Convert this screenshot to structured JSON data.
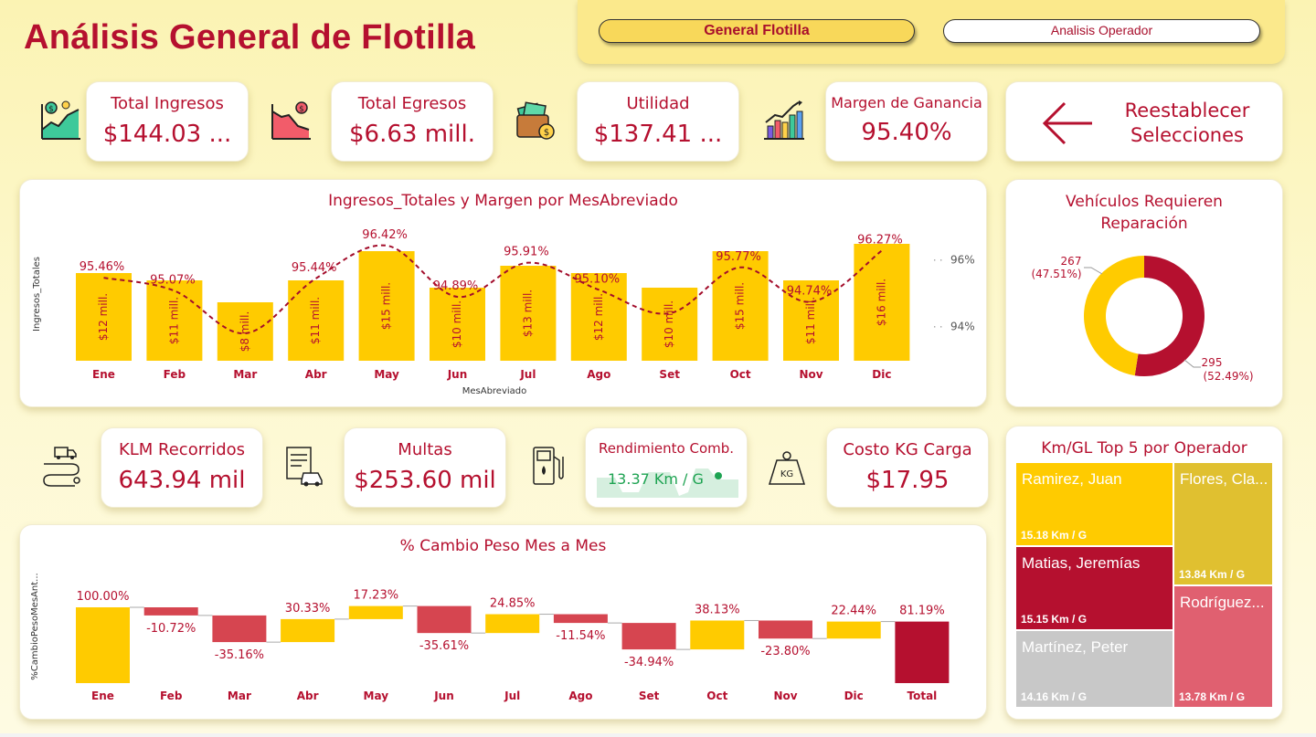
{
  "header": {
    "title": "Análisis General de Flotilla"
  },
  "nav": {
    "general": "General Flotilla",
    "operador": "Analisis Operador"
  },
  "kpis": {
    "ingresos": {
      "label": "Total Ingresos",
      "value": "$144.03 ..."
    },
    "egresos": {
      "label": "Total Egresos",
      "value": "$6.63 mill."
    },
    "utilidad": {
      "label": "Utilidad",
      "value": "$137.41 ..."
    },
    "margen": {
      "label": "Margen de Ganancia",
      "value": "95.40%"
    },
    "reset": {
      "line1": "Reestablecer",
      "line2": "Selecciones"
    },
    "klm": {
      "label": "KLM Recorridos",
      "value": "643.94 mil"
    },
    "multas": {
      "label": "Multas",
      "value": "$253.60 mil"
    },
    "rendimiento": {
      "label": "Rendimiento Comb.",
      "value": "13.37 Km / G"
    },
    "costo": {
      "label": "Costo KG Carga",
      "value": "$17.95"
    }
  },
  "colors": {
    "accent": "#b5102f",
    "yellow": "#ffcb00",
    "red": "#d64550",
    "gold": "#e0c030",
    "gray": "#c8c8c8"
  },
  "icons": [
    "income-chart-icon",
    "expense-chart-icon",
    "wallet-icon",
    "growth-chart-icon",
    "arrow-left-icon",
    "truck-route-icon",
    "ticket-car-icon",
    "fuel-pump-icon",
    "weight-icon"
  ],
  "chart_data": [
    {
      "type": "bar",
      "title": "Ingresos_Totales y Margen por MesAbreviado",
      "xlabel": "MesAbreviado",
      "ylabel": "Ingresos_Totales",
      "categories": [
        "Ene",
        "Feb",
        "Mar",
        "Abr",
        "May",
        "Jun",
        "Jul",
        "Ago",
        "Set",
        "Oct",
        "Nov",
        "Dic"
      ],
      "series": [
        {
          "values": [
            12,
            11,
            8,
            11,
            15,
            10,
            13,
            12,
            10,
            15,
            11,
            16
          ],
          "labels": [
            "$12 mill.",
            "$11 mill.",
            "$8 mill.",
            "$11 mill.",
            "$15 mill.",
            "$10 mill.",
            "$13 mill.",
            "$12 mill.",
            "$10 mill.",
            "$15 mill.",
            "$11 mill.",
            "$16 mill."
          ]
        },
        {
          "values": [
            95.46,
            95.07,
            93.8,
            95.44,
            96.42,
            94.89,
            95.91,
            95.1,
            94.4,
            95.77,
            94.74,
            96.27
          ],
          "labels": [
            "95.46%",
            "95.07%",
            "",
            "95.44%",
            "96.42%",
            "94.89%",
            "95.91%",
            "95.10%",
            "",
            "95.77%",
            "94.74%",
            "96.27%"
          ]
        }
      ],
      "y2ticks": [
        "96%",
        "94%"
      ],
      "y2ticks_values": [
        96,
        94
      ]
    },
    {
      "type": "pie",
      "title": "Vehículos Requieren Reparación",
      "values": [
        267,
        295
      ],
      "labels": [
        "267",
        "295"
      ],
      "percents": [
        "(47.51%)",
        "(52.49%)"
      ],
      "colors": [
        "#ffcb00",
        "#b5102f"
      ]
    },
    {
      "type": "bar",
      "subtype": "waterfall",
      "title": "% Cambio Peso Mes a Mes",
      "ylabel": "%CambioPesoMesAnt...",
      "categories": [
        "Ene",
        "Feb",
        "Mar",
        "Abr",
        "May",
        "Jun",
        "Jul",
        "Ago",
        "Set",
        "Oct",
        "Nov",
        "Dic",
        "Total"
      ],
      "values": [
        100.0,
        -10.72,
        -35.16,
        30.33,
        17.23,
        -35.61,
        24.85,
        -11.54,
        -34.94,
        38.13,
        -23.8,
        22.44,
        81.19
      ],
      "labels": [
        "100.00%",
        "-10.72%",
        "-35.16%",
        "30.33%",
        "17.23%",
        "-35.61%",
        "24.85%",
        "-11.54%",
        "-34.94%",
        "38.13%",
        "-23.80%",
        "22.44%",
        "81.19%"
      ]
    },
    {
      "type": "treemap",
      "title": "Km/GL Top 5 por Operador",
      "items": [
        {
          "name": "Ramirez, Juan",
          "value": 15.18,
          "label": "15.18 Km / G"
        },
        {
          "name": "Matias, Jeremías",
          "value": 15.15,
          "label": "15.15 Km / G"
        },
        {
          "name": "Martínez, Peter",
          "value": 14.16,
          "label": "14.16 Km / G"
        },
        {
          "name": "Flores, Cla...",
          "value": 13.84,
          "label": "13.84 Km / G"
        },
        {
          "name": "Rodríguez...",
          "value": 13.78,
          "label": "13.78 Km / G"
        }
      ]
    }
  ]
}
